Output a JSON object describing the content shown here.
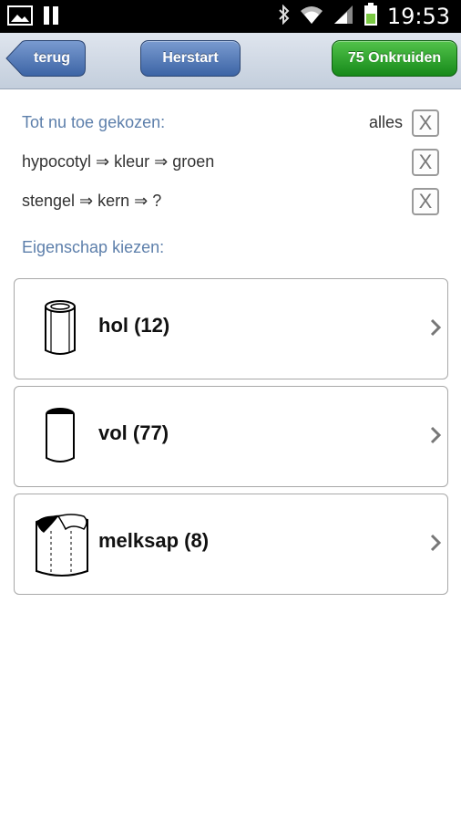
{
  "status_bar": {
    "time": "19:53",
    "icons": [
      "image-notification-icon",
      "pause-icon",
      "bluetooth-icon",
      "wifi-icon",
      "signal-icon",
      "battery-icon"
    ],
    "battery_color": "#7ac943"
  },
  "toolbar": {
    "back_label": "terug",
    "restart_label": "Herstart",
    "results_label": "75 Onkruiden",
    "colors": {
      "blue": "#3c64a5",
      "green": "#16891a"
    }
  },
  "chosen": {
    "heading": "Tot nu toe gekozen:",
    "all_label": "alles",
    "items": [
      {
        "text": "hypocotyl ⇒ kleur ⇒ groen",
        "remove": "X"
      },
      {
        "text": "stengel ⇒ kern ⇒ ?",
        "remove": "X"
      }
    ],
    "all_remove": "X"
  },
  "choose": {
    "heading": "Eigenschap kiezen:",
    "options": [
      {
        "label": "hol (12)",
        "icon": "hollow-stem-icon"
      },
      {
        "label": "vol (77)",
        "icon": "solid-stem-icon"
      },
      {
        "label": "melksap (8)",
        "icon": "milky-sap-stem-icon"
      }
    ]
  },
  "accent_color": "#5d7fab"
}
